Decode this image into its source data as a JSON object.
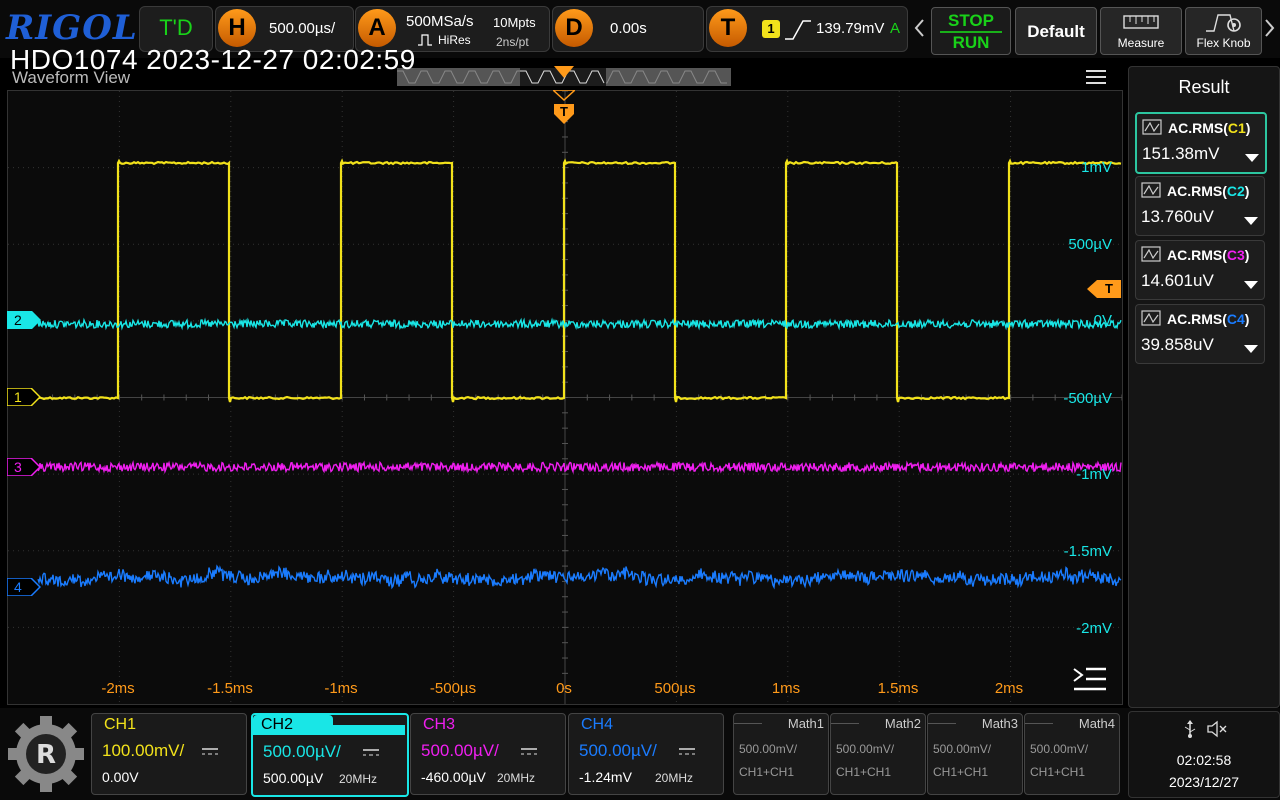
{
  "brand": "RIGOL",
  "device_title": "HDO1074 2023-12-27 02:02:59",
  "view_label": "Waveform View",
  "topbar": {
    "trig_mode": "T'D",
    "h_letter": "H",
    "timebase": "500.00µs/",
    "a_letter": "A",
    "sample_rate": "500MSa/s",
    "mem_depth": "10Mpts",
    "acq_mode": "HiRes",
    "resolution": "2ns/pt",
    "d_letter": "D",
    "delay": "0.00s",
    "t_letter": "T",
    "trig_source": "1",
    "trig_level": "139.79mV",
    "trig_status": "A",
    "stop_label": "STOP",
    "run_label": "RUN",
    "default_label": "Default",
    "measure_label": "Measure",
    "flexknob_label": "Flex Knob"
  },
  "colors": {
    "ch1": "#f2e21b",
    "ch2": "#19e6e6",
    "ch3": "#f01ff0",
    "ch4": "#1a7cff",
    "accent": "#ff9a1a"
  },
  "waveform": {
    "trigger_marker": "T",
    "level_marker": "T",
    "time_labels": [
      "-2ms",
      "-1.5ms",
      "-1ms",
      "-500µs",
      "0s",
      "500µs",
      "1ms",
      "1.5ms",
      "2ms"
    ],
    "ch2_scale_labels": [
      "1mV",
      "500µV",
      "0V",
      "-500µV",
      "-1mV",
      "-1.5mV",
      "-2mV"
    ],
    "channel_markers": [
      "1",
      "2",
      "3",
      "4"
    ]
  },
  "results": {
    "title": "Result",
    "items": [
      {
        "name": "AC.RMS(",
        "ch": "C1",
        "close": ")",
        "value": "151.38mV",
        "color": "#f2e21b"
      },
      {
        "name": "AC.RMS(",
        "ch": "C2",
        "close": ")",
        "value": "13.760uV",
        "color": "#19e6e6"
      },
      {
        "name": "AC.RMS(",
        "ch": "C3",
        "close": ")",
        "value": "14.601uV",
        "color": "#f01ff0"
      },
      {
        "name": "AC.RMS(",
        "ch": "C4",
        "close": ")",
        "value": "39.858uV",
        "color": "#1a7cff"
      }
    ]
  },
  "channels": [
    {
      "label": "CH1",
      "scale": "100.00mV/",
      "offset": "0.00V",
      "bw": ""
    },
    {
      "label": "CH2",
      "scale": "500.00µV/",
      "offset": "500.00µV",
      "bw": "20MHz"
    },
    {
      "label": "CH3",
      "scale": "500.00µV/",
      "offset": "-460.00µV",
      "bw": "20MHz"
    },
    {
      "label": "CH4",
      "scale": "500.00µV/",
      "offset": "-1.24mV",
      "bw": "20MHz"
    }
  ],
  "math": [
    {
      "label": "Math1",
      "scale": "500.00mV/",
      "src": "CH1+CH1"
    },
    {
      "label": "Math2",
      "scale": "500.00mV/",
      "src": "CH1+CH1"
    },
    {
      "label": "Math3",
      "scale": "500.00mV/",
      "src": "CH1+CH1"
    },
    {
      "label": "Math4",
      "scale": "500.00mV/",
      "src": "CH1+CH1"
    }
  ],
  "clock": {
    "time": "02:02:58",
    "date": "2023/12/27"
  }
}
